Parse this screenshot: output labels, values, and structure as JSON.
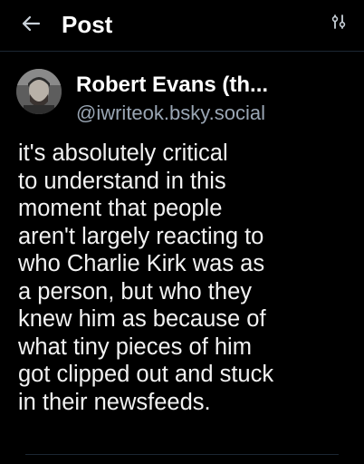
{
  "header": {
    "title": "Post",
    "back_icon": "arrow-left-icon",
    "settings_icon": "sliders-icon"
  },
  "post": {
    "author": {
      "display_name": "Robert Evans (th...",
      "handle": "@iwriteok.bsky.social"
    },
    "text": "it's absolutely critical\nto understand in this\nmoment that people\naren't largely reacting to\nwho Charlie Kirk was as\na person, but who they\nknew him as because of\nwhat tiny pieces of him\ngot clipped out and stuck\nin their newsfeeds."
  },
  "colors": {
    "background": "#000000",
    "text": "#ffffff",
    "handle": "#9aa6b4",
    "divider": "#1c2733"
  }
}
